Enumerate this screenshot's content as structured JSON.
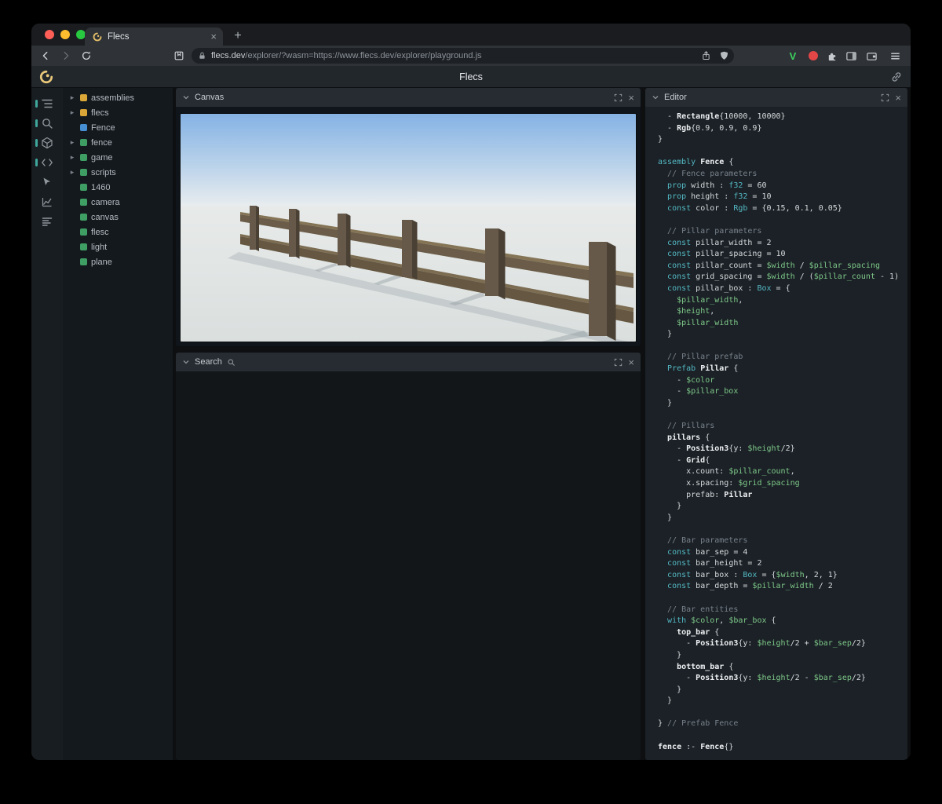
{
  "browser": {
    "tab_title": "Flecs",
    "tab_close_glyph": "×",
    "new_tab_label": "+",
    "url_domain": "flecs.dev",
    "url_path": "/explorer/?wasm=https://www.flecs.dev/explorer/playground.js",
    "v_badge": "V",
    "menu_icon_names": [
      "back-icon",
      "forward-icon",
      "reload-icon",
      "bookmark-icon",
      "lock-icon",
      "share-icon",
      "shield-icon",
      "v-extension-icon",
      "record-extension-icon",
      "extensions-puzzle-icon",
      "side-panel-icon",
      "wallet-icon",
      "menu-icon"
    ]
  },
  "header": {
    "title": "Flecs"
  },
  "rail_icon_names": [
    "entity-tree-icon",
    "search-icon",
    "canvas-cube-icon",
    "code-icon",
    "inspect-cursor-icon",
    "chart-icon",
    "stats-rows-icon"
  ],
  "panels": {
    "canvas": {
      "title": "Canvas"
    },
    "search": {
      "title": "Search"
    },
    "editor": {
      "title": "Editor"
    },
    "close_glyph": "×"
  },
  "tree": {
    "items": [
      {
        "arrow": true,
        "dot": "#daa637",
        "label": "assemblies"
      },
      {
        "arrow": true,
        "dot": "#daa637",
        "label": "flecs"
      },
      {
        "arrow": false,
        "dot": "#458fd2",
        "label": "Fence"
      },
      {
        "arrow": true,
        "dot": "#3f9e63",
        "label": "fence"
      },
      {
        "arrow": true,
        "dot": "#3f9e63",
        "label": "game"
      },
      {
        "arrow": true,
        "dot": "#3f9e63",
        "label": "scripts"
      },
      {
        "arrow": false,
        "dot": "#3f9e63",
        "label": "1460"
      },
      {
        "arrow": false,
        "dot": "#3f9e63",
        "label": "camera"
      },
      {
        "arrow": false,
        "dot": "#3f9e63",
        "label": "canvas"
      },
      {
        "arrow": false,
        "dot": "#3f9e63",
        "label": "flesc"
      },
      {
        "arrow": false,
        "dot": "#3f9e63",
        "label": "light"
      },
      {
        "arrow": false,
        "dot": "#3f9e63",
        "label": "plane"
      }
    ]
  },
  "editor": {
    "lines": [
      [
        [
          "p",
          "  - "
        ],
        [
          "b",
          "Rectangle"
        ],
        [
          "p",
          "{10000, 10000}"
        ]
      ],
      [
        [
          "p",
          "  - "
        ],
        [
          "b",
          "Rgb"
        ],
        [
          "p",
          "{0.9, 0.9, 0.9}"
        ]
      ],
      [
        [
          "p",
          "}"
        ]
      ],
      [],
      [
        [
          "k",
          "assembly "
        ],
        [
          "b",
          "Fence"
        ],
        [
          "p",
          " {"
        ]
      ],
      [
        [
          "c",
          "  // Fence parameters"
        ]
      ],
      [
        [
          "p",
          "  "
        ],
        [
          "k",
          "prop "
        ],
        [
          "p",
          "width : "
        ],
        [
          "k",
          "f32"
        ],
        [
          "p",
          " = 60"
        ]
      ],
      [
        [
          "p",
          "  "
        ],
        [
          "k",
          "prop "
        ],
        [
          "p",
          "height : "
        ],
        [
          "k",
          "f32"
        ],
        [
          "p",
          " = 10"
        ]
      ],
      [
        [
          "p",
          "  "
        ],
        [
          "k",
          "const "
        ],
        [
          "p",
          "color : "
        ],
        [
          "k",
          "Rgb"
        ],
        [
          "p",
          " = {0.15, 0.1, 0.05}"
        ]
      ],
      [],
      [
        [
          "c",
          "  // Pillar parameters"
        ]
      ],
      [
        [
          "p",
          "  "
        ],
        [
          "k",
          "const "
        ],
        [
          "p",
          "pillar_width = 2"
        ]
      ],
      [
        [
          "p",
          "  "
        ],
        [
          "k",
          "const "
        ],
        [
          "p",
          "pillar_spacing = 10"
        ]
      ],
      [
        [
          "p",
          "  "
        ],
        [
          "k",
          "const "
        ],
        [
          "p",
          "pillar_count = "
        ],
        [
          "v",
          "$width"
        ],
        [
          "p",
          " / "
        ],
        [
          "v",
          "$pillar_spacing"
        ]
      ],
      [
        [
          "p",
          "  "
        ],
        [
          "k",
          "const "
        ],
        [
          "p",
          "grid_spacing = "
        ],
        [
          "v",
          "$width"
        ],
        [
          "p",
          " / ("
        ],
        [
          "v",
          "$pillar_count"
        ],
        [
          "p",
          " - 1)"
        ]
      ],
      [
        [
          "p",
          "  "
        ],
        [
          "k",
          "const "
        ],
        [
          "p",
          "pillar_box : "
        ],
        [
          "k",
          "Box"
        ],
        [
          "p",
          " = {"
        ]
      ],
      [
        [
          "p",
          "    "
        ],
        [
          "v",
          "$pillar_width"
        ],
        [
          "p",
          ","
        ]
      ],
      [
        [
          "p",
          "    "
        ],
        [
          "v",
          "$height"
        ],
        [
          "p",
          ","
        ]
      ],
      [
        [
          "p",
          "    "
        ],
        [
          "v",
          "$pillar_width"
        ]
      ],
      [
        [
          "p",
          "  }"
        ]
      ],
      [],
      [
        [
          "c",
          "  // Pillar prefab"
        ]
      ],
      [
        [
          "p",
          "  "
        ],
        [
          "k",
          "Prefab "
        ],
        [
          "b",
          "Pillar"
        ],
        [
          "p",
          " {"
        ]
      ],
      [
        [
          "p",
          "    - "
        ],
        [
          "v",
          "$color"
        ]
      ],
      [
        [
          "p",
          "    - "
        ],
        [
          "v",
          "$pillar_box"
        ]
      ],
      [
        [
          "p",
          "  }"
        ]
      ],
      [],
      [
        [
          "c",
          "  // Pillars"
        ]
      ],
      [
        [
          "p",
          "  "
        ],
        [
          "b",
          "pillars"
        ],
        [
          "p",
          " {"
        ]
      ],
      [
        [
          "p",
          "    - "
        ],
        [
          "b",
          "Position3"
        ],
        [
          "p",
          "{y: "
        ],
        [
          "v",
          "$height"
        ],
        [
          "p",
          "/2}"
        ]
      ],
      [
        [
          "p",
          "    - "
        ],
        [
          "b",
          "Grid"
        ],
        [
          "p",
          "{"
        ]
      ],
      [
        [
          "p",
          "      x.count: "
        ],
        [
          "v",
          "$pillar_count"
        ],
        [
          "p",
          ","
        ]
      ],
      [
        [
          "p",
          "      x.spacing: "
        ],
        [
          "v",
          "$grid_spacing"
        ]
      ],
      [
        [
          "p",
          "      prefab: "
        ],
        [
          "b",
          "Pillar"
        ]
      ],
      [
        [
          "p",
          "    }"
        ]
      ],
      [
        [
          "p",
          "  }"
        ]
      ],
      [],
      [
        [
          "c",
          "  // Bar parameters"
        ]
      ],
      [
        [
          "p",
          "  "
        ],
        [
          "k",
          "const "
        ],
        [
          "p",
          "bar_sep = 4"
        ]
      ],
      [
        [
          "p",
          "  "
        ],
        [
          "k",
          "const "
        ],
        [
          "p",
          "bar_height = 2"
        ]
      ],
      [
        [
          "p",
          "  "
        ],
        [
          "k",
          "const "
        ],
        [
          "p",
          "bar_box : "
        ],
        [
          "k",
          "Box"
        ],
        [
          "p",
          " = {"
        ],
        [
          "v",
          "$width"
        ],
        [
          "p",
          ", 2, 1}"
        ]
      ],
      [
        [
          "p",
          "  "
        ],
        [
          "k",
          "const "
        ],
        [
          "p",
          "bar_depth = "
        ],
        [
          "v",
          "$pillar_width"
        ],
        [
          "p",
          " / 2"
        ]
      ],
      [],
      [
        [
          "c",
          "  // Bar entities"
        ]
      ],
      [
        [
          "p",
          "  "
        ],
        [
          "k",
          "with "
        ],
        [
          "v",
          "$color"
        ],
        [
          "p",
          ", "
        ],
        [
          "v",
          "$bar_box"
        ],
        [
          "p",
          " {"
        ]
      ],
      [
        [
          "p",
          "    "
        ],
        [
          "b",
          "top_bar"
        ],
        [
          "p",
          " {"
        ]
      ],
      [
        [
          "p",
          "      - "
        ],
        [
          "b",
          "Position3"
        ],
        [
          "p",
          "{y: "
        ],
        [
          "v",
          "$height"
        ],
        [
          "p",
          "/2 + "
        ],
        [
          "v",
          "$bar_sep"
        ],
        [
          "p",
          "/2}"
        ]
      ],
      [
        [
          "p",
          "    }"
        ]
      ],
      [
        [
          "p",
          "    "
        ],
        [
          "b",
          "bottom_bar"
        ],
        [
          "p",
          " {"
        ]
      ],
      [
        [
          "p",
          "      - "
        ],
        [
          "b",
          "Position3"
        ],
        [
          "p",
          "{y: "
        ],
        [
          "v",
          "$height"
        ],
        [
          "p",
          "/2 - "
        ],
        [
          "v",
          "$bar_sep"
        ],
        [
          "p",
          "/2}"
        ]
      ],
      [
        [
          "p",
          "    }"
        ]
      ],
      [
        [
          "p",
          "  }"
        ]
      ],
      [],
      [
        [
          "p",
          "} "
        ],
        [
          "c",
          "// Prefab Fence"
        ]
      ],
      [],
      [
        [
          "b",
          "fence"
        ],
        [
          "p",
          " :- "
        ],
        [
          "b",
          "Fence"
        ],
        [
          "p",
          "{}"
        ]
      ]
    ]
  },
  "colors": {
    "accent_teal": "#3fa79c",
    "tree_yellow": "#daa637",
    "tree_green": "#3f9e63",
    "tree_blue": "#458fd2",
    "fence_brown": "#66594a",
    "sky_blue": "#85b2e4"
  }
}
